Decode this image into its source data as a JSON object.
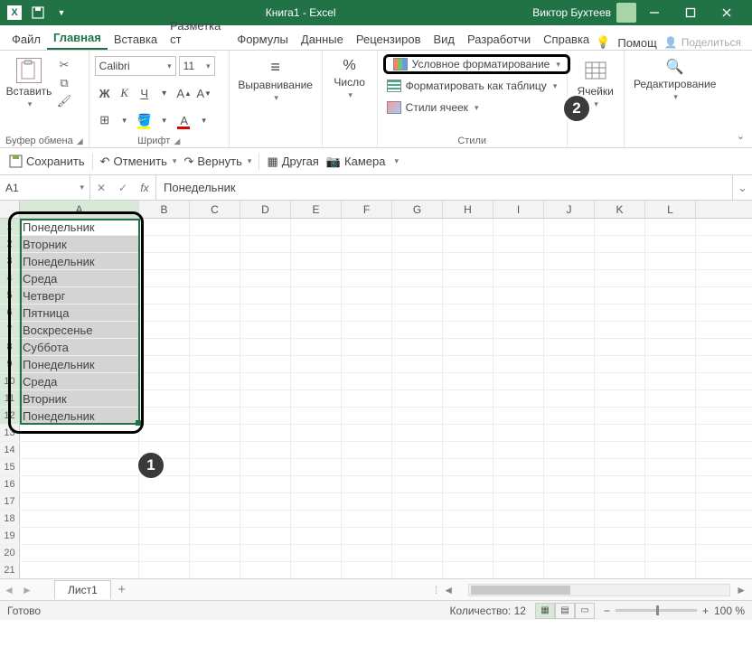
{
  "titlebar": {
    "doc_name": "Книга1",
    "app_name": "Excel",
    "title_text": "Книга1  -  Excel",
    "user_name": "Виктор Бухтеев"
  },
  "ribbon_tabs": {
    "file": "Файл",
    "home": "Главная",
    "insert": "Вставка",
    "pagelayout": "Разметка ст",
    "formulas": "Формулы",
    "data": "Данные",
    "review": "Рецензиров",
    "view": "Вид",
    "developer": "Разработчи",
    "help": "Справка",
    "tellme": "Помощ",
    "share": "Поделиться"
  },
  "ribbon": {
    "clipboard": {
      "paste": "Вставить",
      "label": "Буфер обмена"
    },
    "font": {
      "name": "Calibri",
      "size": "11",
      "label": "Шрифт"
    },
    "alignment": {
      "label": "Выравнивание"
    },
    "number": {
      "label": "Число"
    },
    "styles": {
      "conditional": "Условное форматирование",
      "format_table": "Форматировать как таблицу",
      "cell_styles": "Стили ячеек",
      "label": "Стили"
    },
    "cells": {
      "label": "Ячейки"
    },
    "editing": {
      "label": "Редактирование"
    }
  },
  "qat": {
    "save": "Сохранить",
    "undo": "Отменить",
    "redo": "Вернуть",
    "other": "Другая",
    "camera": "Камера"
  },
  "namebox": "A1",
  "formula": "Понедельник",
  "columns": [
    "A",
    "B",
    "C",
    "D",
    "E",
    "F",
    "G",
    "H",
    "I",
    "J",
    "K",
    "L"
  ],
  "rows": [
    "Понедельник",
    "Вторник",
    "Понедельник",
    "Среда",
    "Четверг",
    "Пятница",
    "Воскресенье",
    "Суббота",
    "Понедельник",
    "Среда",
    "Вторник",
    "Понедельник"
  ],
  "total_rows_shown": 21,
  "sheet": {
    "name": "Лист1"
  },
  "status": {
    "ready": "Готово",
    "count_label": "Количество:",
    "count_value": "12",
    "zoom": "100 %"
  },
  "annotations": {
    "b1": "1",
    "b2": "2"
  }
}
